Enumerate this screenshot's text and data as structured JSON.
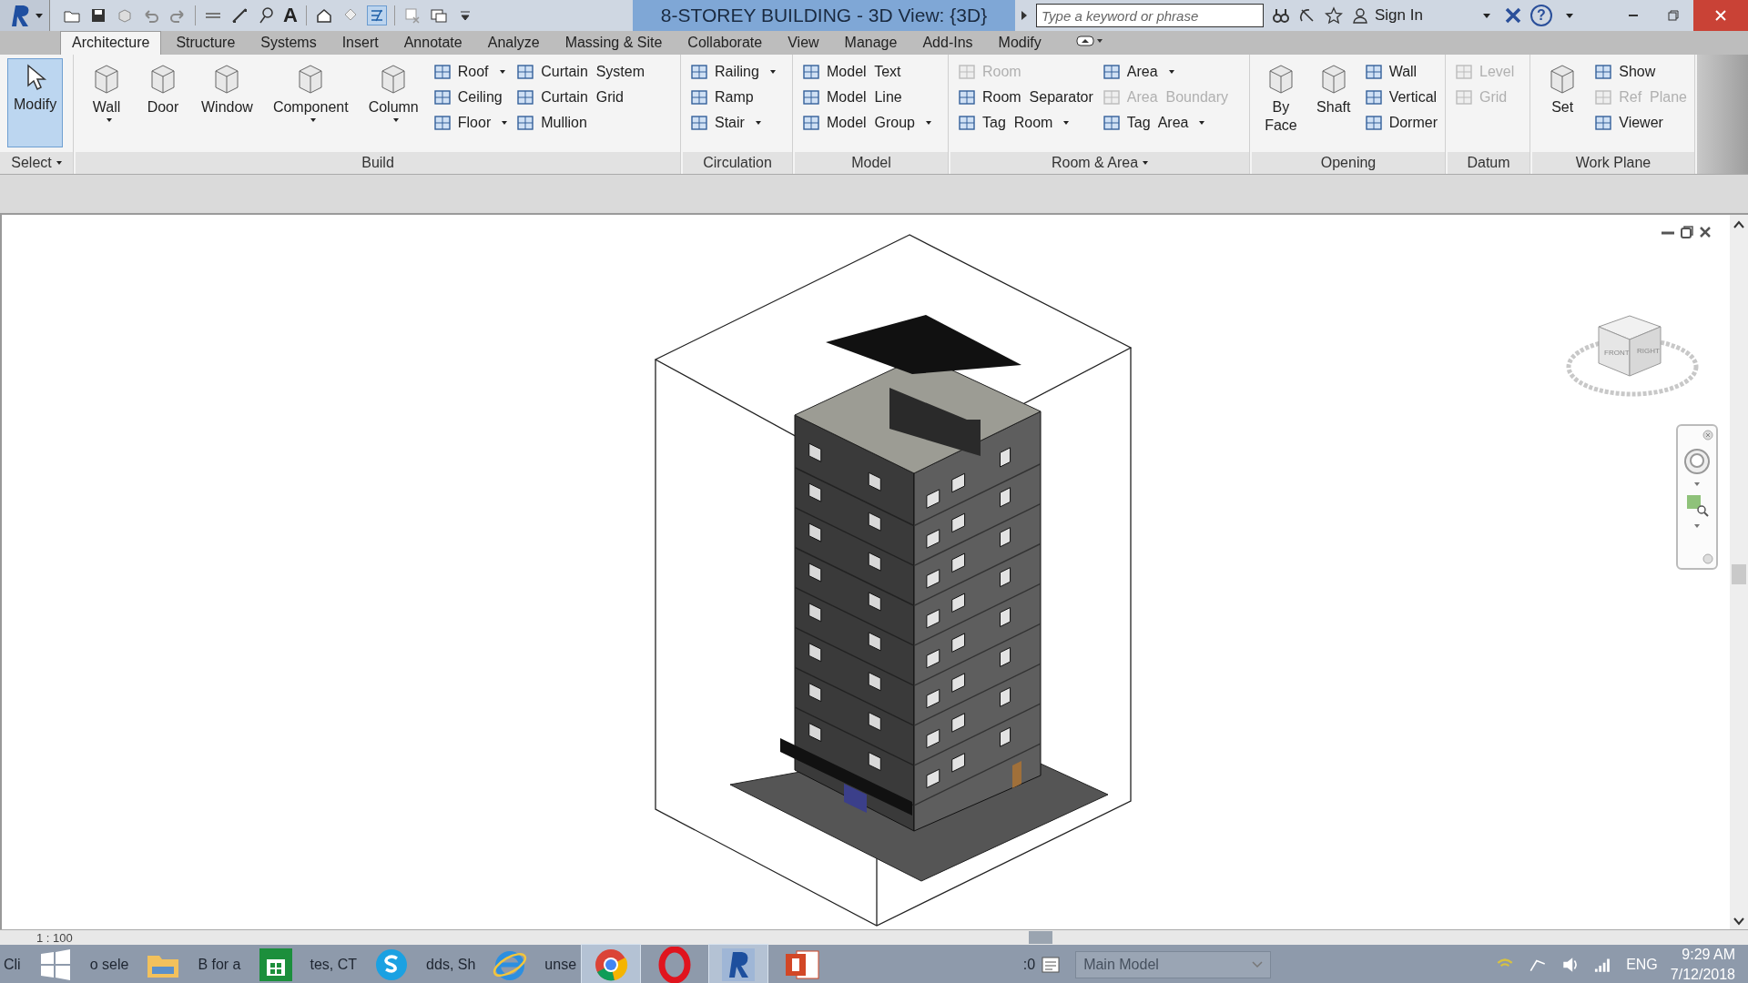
{
  "app_menu": {
    "dropdown": true
  },
  "quick_access": {
    "text_glyph": "A"
  },
  "window": {
    "title": "8-STOREY BUILDING - 3D View: {3D}"
  },
  "search": {
    "placeholder": "Type a keyword or phrase"
  },
  "account": {
    "label": "Sign In"
  },
  "help": {
    "glyph": "?"
  },
  "tabs": [
    {
      "label": "Architecture",
      "selected": true
    },
    {
      "label": "Structure",
      "selected": false
    },
    {
      "label": "Systems",
      "selected": false
    },
    {
      "label": "Insert",
      "selected": false
    },
    {
      "label": "Annotate",
      "selected": false
    },
    {
      "label": "Analyze",
      "selected": false
    },
    {
      "label": "Massing & Site",
      "selected": false
    },
    {
      "label": "Collaborate",
      "selected": false
    },
    {
      "label": "View",
      "selected": false
    },
    {
      "label": "Manage",
      "selected": false
    },
    {
      "label": "Add-Ins",
      "selected": false
    },
    {
      "label": "Modify",
      "selected": false
    }
  ],
  "ribbon_panels": [
    {
      "title": "Select",
      "dropdown": true,
      "tools": [
        {
          "label": "Modify",
          "kind": "select",
          "selected": true
        }
      ]
    },
    {
      "title": "Build",
      "dropdown": false,
      "tools": [
        {
          "label": "Wall",
          "kind": "large",
          "dropdown": true
        },
        {
          "label": "Door",
          "kind": "large",
          "dropdown": false
        },
        {
          "label": "Window",
          "kind": "large",
          "dropdown": false
        },
        {
          "label": "Component",
          "kind": "large",
          "dropdown": true
        },
        {
          "label": "Column",
          "kind": "large",
          "dropdown": true
        },
        {
          "label": "Roof",
          "kind": "small",
          "dropdown": true
        },
        {
          "label": "Ceiling",
          "kind": "small",
          "dropdown": false
        },
        {
          "label": "Floor",
          "kind": "small",
          "dropdown": true
        },
        {
          "label": "Curtain  System",
          "kind": "small",
          "dropdown": false
        },
        {
          "label": "Curtain  Grid",
          "kind": "small",
          "dropdown": false
        },
        {
          "label": "Mullion",
          "kind": "small",
          "dropdown": false
        }
      ]
    },
    {
      "title": "Circulation",
      "dropdown": false,
      "tools": [
        {
          "label": "Railing",
          "kind": "small",
          "dropdown": true
        },
        {
          "label": "Ramp",
          "kind": "small",
          "dropdown": false
        },
        {
          "label": "Stair",
          "kind": "small",
          "dropdown": true
        }
      ]
    },
    {
      "title": "Model",
      "dropdown": false,
      "tools": [
        {
          "label": "Model  Text",
          "kind": "small",
          "dropdown": false
        },
        {
          "label": "Model  Line",
          "kind": "small",
          "dropdown": false
        },
        {
          "label": "Model  Group",
          "kind": "small",
          "dropdown": true
        }
      ]
    },
    {
      "title": "Room & Area",
      "dropdown": true,
      "tools": [
        {
          "label": "Room",
          "kind": "small",
          "dropdown": false,
          "disabled": true
        },
        {
          "label": "Room  Separator",
          "kind": "small",
          "dropdown": false,
          "disabled": false
        },
        {
          "label": "Tag  Room",
          "kind": "small",
          "dropdown": true,
          "disabled": false
        },
        {
          "label": "Area",
          "kind": "small",
          "dropdown": true,
          "disabled": false
        },
        {
          "label": "Area  Boundary",
          "kind": "small",
          "dropdown": false,
          "disabled": true
        },
        {
          "label": "Tag  Area",
          "kind": "small",
          "dropdown": true,
          "disabled": false
        }
      ]
    },
    {
      "title": "Opening",
      "dropdown": false,
      "tools": [
        {
          "label": "By\nFace",
          "kind": "large",
          "dropdown": false
        },
        {
          "label": "Shaft",
          "kind": "large",
          "dropdown": false
        },
        {
          "label": "Wall",
          "kind": "small",
          "dropdown": false
        },
        {
          "label": "Vertical",
          "kind": "small",
          "dropdown": false
        },
        {
          "label": "Dormer",
          "kind": "small",
          "dropdown": false
        }
      ]
    },
    {
      "title": "Datum",
      "dropdown": false,
      "tools": [
        {
          "label": "Level",
          "kind": "small",
          "dropdown": false,
          "disabled": true
        },
        {
          "label": "Grid",
          "kind": "small",
          "dropdown": false,
          "disabled": true
        }
      ]
    },
    {
      "title": "Work Plane",
      "dropdown": false,
      "tools": [
        {
          "label": "Set",
          "kind": "large",
          "dropdown": false,
          "disabled": false
        },
        {
          "label": "Show",
          "kind": "small",
          "dropdown": false,
          "disabled": false
        },
        {
          "label": "Ref  Plane",
          "kind": "small",
          "dropdown": false,
          "disabled": true
        },
        {
          "label": "Viewer",
          "kind": "small",
          "dropdown": false,
          "disabled": false
        }
      ]
    }
  ],
  "viewcube": {
    "faces": [
      "FRONT",
      "RIGHT"
    ]
  },
  "view_control_bar": {
    "scale": "1 : 100"
  },
  "status_bar": {
    "hint_fragments": [
      "Cli",
      "o sele",
      "B for a",
      "tes, CT",
      "dds, Sh",
      "unse"
    ],
    "count": ":0",
    "model": "Main Model"
  },
  "tray": {
    "language": "ENG",
    "time": "9:29 AM",
    "date": "7/12/2018"
  }
}
